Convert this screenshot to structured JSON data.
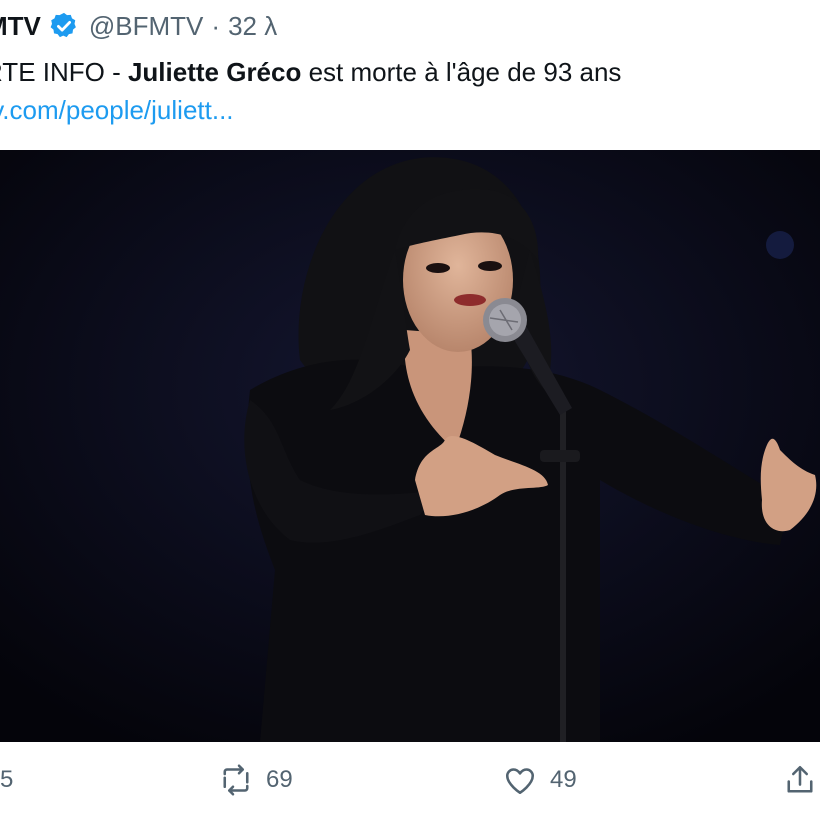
{
  "tweet": {
    "display_name": "MTV",
    "handle": "@BFMTV",
    "separator": "·",
    "time": "32 λ",
    "text_prefix": "RTE INFO - ",
    "text_bold": "Juliette Gréco",
    "text_suffix": " est morte à l'âge de 93 ans",
    "link": "tv.com/people/juliett..."
  },
  "media": {
    "description_icon": "photo-singer-at-microphone"
  },
  "actions": {
    "reply_count": "5",
    "retweet_count": "69",
    "like_count": "49"
  },
  "colors": {
    "link": "#1d9bf0",
    "secondary": "#536471",
    "verified": "#1d9bf0",
    "photo_background": "#06060e"
  }
}
